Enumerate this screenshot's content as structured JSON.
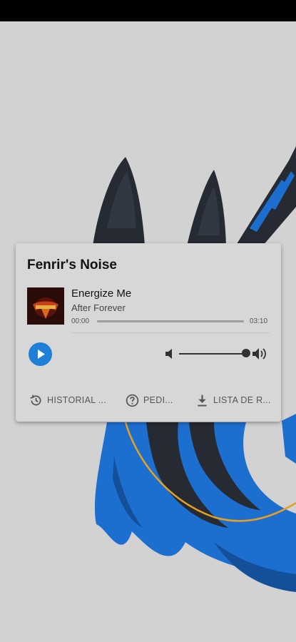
{
  "player": {
    "station_name": "Fenrir's Noise",
    "track_title": "Energize Me",
    "track_artist": "After Forever",
    "album_art": "album-art-after-forever",
    "elapsed": "00:00",
    "duration": "03:10",
    "progress": 0,
    "volume_level": 0.92,
    "play_icon": "play-icon",
    "volume_low_icon": "volume-low-icon",
    "volume_high_icon": "volume-high-icon"
  },
  "actions": [
    {
      "label": "HISTORIAL ...",
      "icon": "history-icon"
    },
    {
      "label": "PEDI...",
      "icon": "help-icon"
    },
    {
      "label": "LISTA DE R...",
      "icon": "download-icon"
    }
  ],
  "colors": {
    "accent": "#1f7fd6",
    "background": "#d2d2d2",
    "card": "#d7d7d7",
    "wallpaper_dark": "#252a33",
    "wallpaper_blue": "#1d6fcf",
    "wallpaper_orange": "#e8a020"
  }
}
